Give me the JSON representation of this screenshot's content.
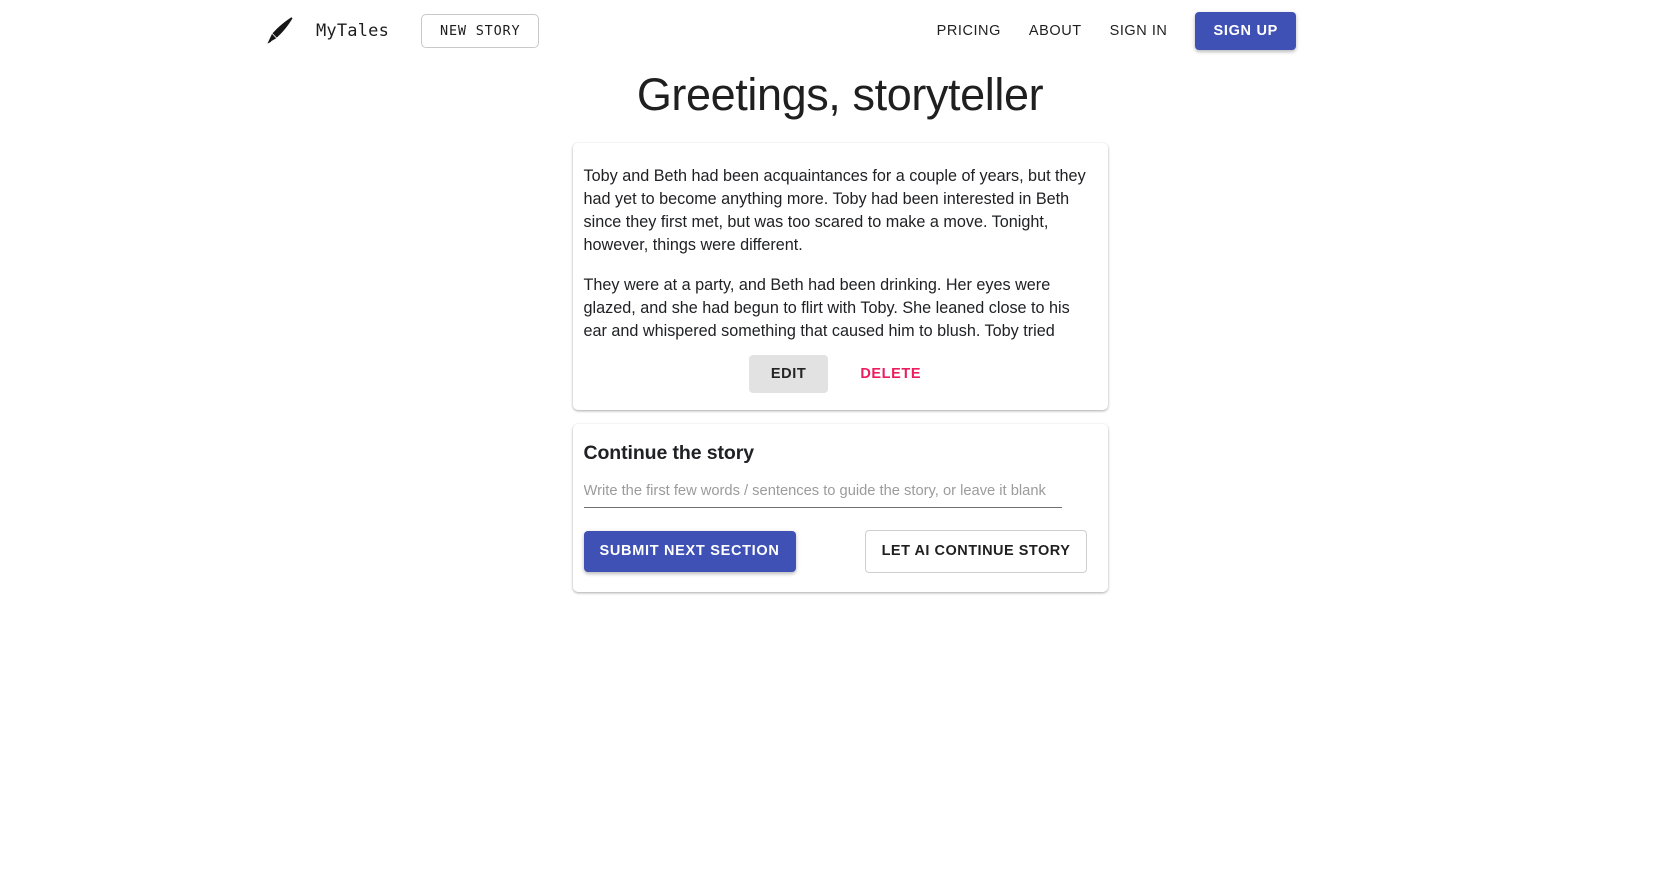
{
  "header": {
    "brand_name": "MyTales",
    "logo_icon": "quill-pen-icon",
    "new_story_label": "NEW STORY",
    "nav": [
      {
        "label": "PRICING",
        "name": "pricing"
      },
      {
        "label": "ABOUT",
        "name": "about"
      },
      {
        "label": "SIGN IN",
        "name": "sign-in"
      }
    ],
    "signup_label": "SIGN UP",
    "accent_color": "#3f51b5"
  },
  "page": {
    "title": "Greetings, storyteller"
  },
  "story": {
    "paragraphs": [
      "Toby and Beth had been acquaintances for a couple of years, but they had yet to become anything more. Toby had been interested in Beth since they first met, but was too scared to make a move. Tonight, however, things were different.",
      "They were at a party, and Beth had been drinking. Her eyes were glazed, and she had begun to flirt with Toby. She leaned close to his ear and whispered something that caused him to blush. Toby tried"
    ],
    "edit_label": "EDIT",
    "delete_label": "DELETE",
    "delete_color": "#ec1d5e",
    "edit_bg_color": "#e2e2e2"
  },
  "continue": {
    "heading": "Continue the story",
    "input_value": "",
    "input_placeholder": "Write the first few words / sentences to guide the story, or leave it blank",
    "submit_label": "SUBMIT NEXT SECTION",
    "ai_label": "LET AI CONTINUE STORY"
  }
}
